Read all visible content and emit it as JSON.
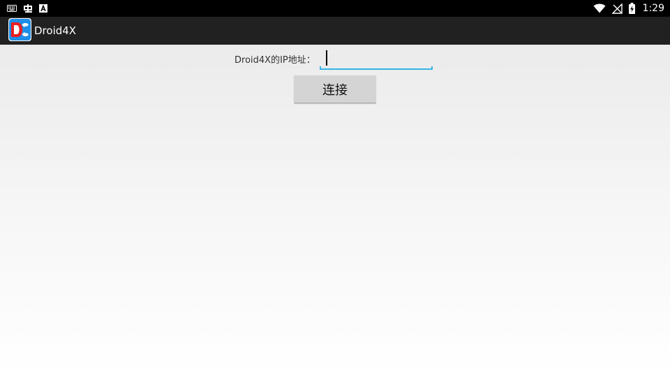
{
  "status_bar": {
    "left_icons": [
      "keyboard-icon",
      "debug-bug-icon",
      "android-a-icon"
    ],
    "right_icons": [
      "wifi-icon",
      "no-signal-icon",
      "battery-charging-icon"
    ],
    "time": "1:29"
  },
  "app_bar": {
    "title": "Droid4X",
    "icon": "droid4x-logo-icon"
  },
  "form": {
    "ip_label": "Droid4X的IP地址：",
    "ip_value": "",
    "connect_label": "连接"
  },
  "colors": {
    "accent": "#33b5e5",
    "app_bar": "#212121",
    "status_bar": "#000000",
    "button": "#d4d4d4"
  }
}
